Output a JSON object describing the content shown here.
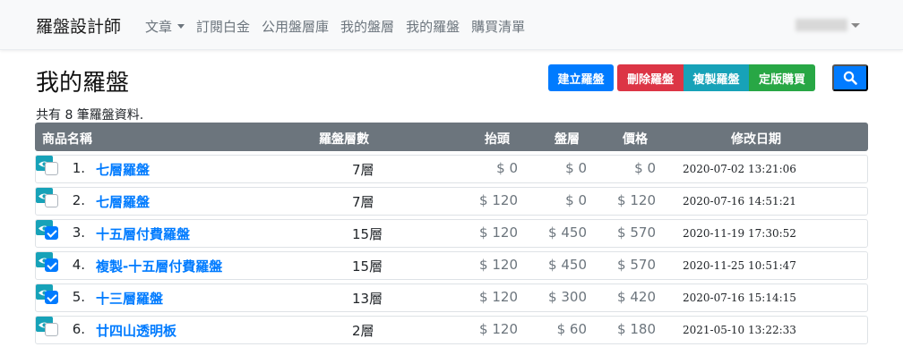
{
  "navbar": {
    "brand": "羅盤設計師",
    "items": [
      {
        "label": "文章",
        "dropdown": true
      },
      {
        "label": "訂閱白金"
      },
      {
        "label": "公用盤層庫"
      },
      {
        "label": "我的盤層"
      },
      {
        "label": "我的羅盤"
      },
      {
        "label": "購買清單"
      }
    ]
  },
  "page": {
    "title": "我的羅盤",
    "count_text": "共有 8 筆羅盤資料.",
    "buttons": {
      "create": "建立羅盤",
      "delete": "刪除羅盤",
      "copy": "複製羅盤",
      "final": "定版購買"
    },
    "search_icon": "search-icon"
  },
  "colors": {
    "primary": "#007bff",
    "danger": "#dc3545",
    "info": "#17a2b8",
    "success": "#28a745",
    "table_header": "#6c757d",
    "eye_icon": "#17a2b8"
  },
  "table": {
    "headers": {
      "name": "商品名稱",
      "layers": "羅盤層數",
      "lift": "抬頭",
      "tray": "盤層",
      "price": "價格",
      "modified": "修改日期"
    },
    "rows": [
      {
        "checked": false,
        "index": "1.",
        "name": "七層羅盤",
        "layers": "7層",
        "lift": "$ 0",
        "tray": "$ 0",
        "price": "$ 0",
        "date": "2020-07-02 13:21:06"
      },
      {
        "checked": false,
        "index": "2.",
        "name": "七層羅盤",
        "layers": "7層",
        "lift": "$ 120",
        "tray": "$ 0",
        "price": "$ 120",
        "date": "2020-07-16 14:51:21"
      },
      {
        "checked": true,
        "index": "3.",
        "name": "十五層付費羅盤",
        "layers": "15層",
        "lift": "$ 120",
        "tray": "$ 450",
        "price": "$ 570",
        "date": "2020-11-19 17:30:52"
      },
      {
        "checked": true,
        "index": "4.",
        "name": "複製-十五層付費羅盤",
        "layers": "15層",
        "lift": "$ 120",
        "tray": "$ 450",
        "price": "$ 570",
        "date": "2020-11-25 10:51:47"
      },
      {
        "checked": true,
        "index": "5.",
        "name": "十三層羅盤",
        "layers": "13層",
        "lift": "$ 120",
        "tray": "$ 300",
        "price": "$ 420",
        "date": "2020-07-16 15:14:15"
      },
      {
        "checked": false,
        "index": "6.",
        "name": "廿四山透明板",
        "layers": "2層",
        "lift": "$ 120",
        "tray": "$ 60",
        "price": "$ 180",
        "date": "2021-05-10 13:22:33"
      }
    ]
  }
}
